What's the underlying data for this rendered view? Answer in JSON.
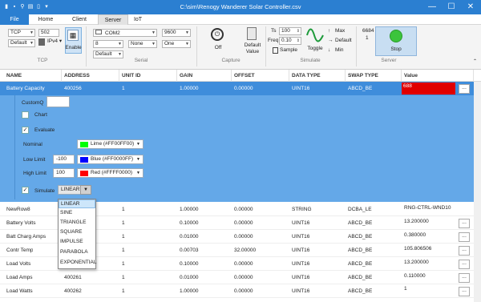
{
  "window": {
    "title": "C:\\sim\\Renogy Wanderer Solar Controller.csv",
    "buttons": {
      "minimize": "—",
      "maximize": "☐",
      "close": "✕"
    }
  },
  "menu": {
    "tabs": [
      "File",
      "Home",
      "Client",
      "Server",
      "IoT"
    ]
  },
  "ribbon": {
    "tcp": {
      "protocol": "TCP",
      "port": "502",
      "ip_mode": "Default",
      "ipv_label": "IPv4",
      "enable_label": "Enable",
      "group_label": "TCP"
    },
    "serial": {
      "port": "COM2",
      "baud": "9600",
      "data_bits": "8",
      "parity": "None",
      "stop_bits": "One",
      "flow": "Default",
      "group_label": "Serial"
    },
    "capture": {
      "off_label": "Off",
      "default_value_label": "Default\nValue",
      "group_label": "Capture"
    },
    "simulate": {
      "ts_label": "Ts",
      "ts_value": "100",
      "freq_label": "Freq",
      "freq_value": "0.10",
      "sample_label": "Sample",
      "toggle_label": "Toggle",
      "max_label": "Max",
      "default_label": "Default",
      "min_label": "Min",
      "group_label": "Simulate"
    },
    "server": {
      "count1": "6684",
      "count2": "1",
      "stop_label": "Stop",
      "group_label": "Server"
    }
  },
  "grid": {
    "headers": [
      "NAME",
      "ADDRESS",
      "UNIT ID",
      "GAIN",
      "OFFSET",
      "DATA TYPE",
      "SWAP TYPE",
      "Value"
    ],
    "selected": {
      "name": "Battery Capacity",
      "address": "400256",
      "unit": "1",
      "gain": "1.00000",
      "offset": "0.00000",
      "dtype": "UINT16",
      "swap": "ABCD_BE",
      "value": "688",
      "btn": "..."
    },
    "rows": [
      {
        "name": "NewRow8",
        "address": "",
        "unit": "1",
        "gain": "1.00000",
        "offset": "0.00000",
        "dtype": "STRING",
        "swap": "DCBA_LE",
        "value": "RNG-CTRL-WND10",
        "btn": ""
      },
      {
        "name": "Battery Volts",
        "address": "",
        "unit": "1",
        "gain": "0.10000",
        "offset": "0.00000",
        "dtype": "UINT16",
        "swap": "ABCD_BE",
        "value": "13.200000",
        "btn": "..."
      },
      {
        "name": "Batt Charg Amps",
        "address": "",
        "unit": "1",
        "gain": "0.01000",
        "offset": "0.00000",
        "dtype": "UINT16",
        "swap": "ABCD_BE",
        "value": "0.380000",
        "btn": "..."
      },
      {
        "name": "Contr Temp",
        "address": "",
        "unit": "1",
        "gain": "0.00703",
        "offset": "32.00000",
        "dtype": "UINT16",
        "swap": "ABCD_BE",
        "value": "105.806506",
        "btn": "..."
      },
      {
        "name": "Load Volts",
        "address": "",
        "unit": "1",
        "gain": "0.10000",
        "offset": "0.00000",
        "dtype": "UINT16",
        "swap": "ABCD_BE",
        "value": "13.200000",
        "btn": "..."
      },
      {
        "name": "Load Amps",
        "address": "400261",
        "unit": "1",
        "gain": "0.01000",
        "offset": "0.00000",
        "dtype": "UINT16",
        "swap": "ABCD_BE",
        "value": "0.110000",
        "btn": "..."
      },
      {
        "name": "Load Watts",
        "address": "400262",
        "unit": "1",
        "gain": "1.00000",
        "offset": "0.00000",
        "dtype": "UINT16",
        "swap": "ABCD_BE",
        "value": "1",
        "btn": "..."
      }
    ]
  },
  "detail": {
    "custom_label": "CustomQ",
    "chart_label": "Chart",
    "evaluate_label": "Evaluate",
    "nominal_label": "Nominal",
    "low_label": "Low Limit",
    "low_value": "-100",
    "high_label": "High Limit",
    "high_value": "100",
    "simulate_label": "Simulate",
    "nominal_color": {
      "label": "Lime (#FF00FF00)",
      "hex": "#00ff00"
    },
    "low_color": {
      "label": "Blue (#FF0000FF)",
      "hex": "#0000ff"
    },
    "high_color": {
      "label": "Red (#FFFF0000)",
      "hex": "#ff0000"
    },
    "sim_mode": "LINEAR",
    "sim_options": [
      "LINEAR",
      "SINE",
      "TRIANGLE",
      "SQUARE",
      "IMPULSE",
      "PARABOLA",
      "EXPONENTIAL"
    ]
  },
  "colors": {
    "accent": "#2b7fd1",
    "selected_row": "#3f8ddb",
    "detail_bg": "#64a8e8",
    "alarm": "#e00000",
    "stop_btn": "#3cc43c"
  }
}
